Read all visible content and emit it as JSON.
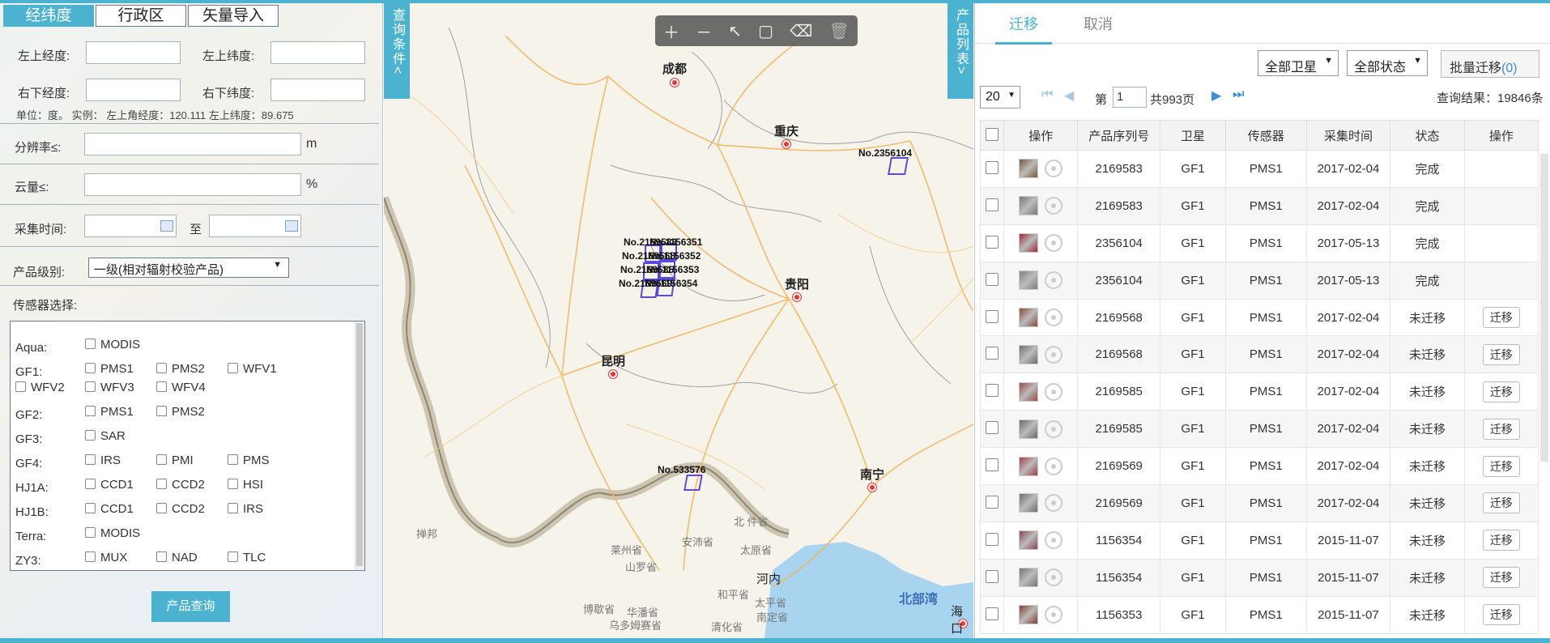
{
  "left_panel": {
    "tabs": [
      "经纬度",
      "行政区",
      "矢量导入"
    ],
    "fields": {
      "top_left_lon": "左上经度:",
      "top_left_lat": "左上纬度:",
      "bottom_right_lon": "右下经度:",
      "bottom_right_lat": "右下纬度:"
    },
    "note": "单位：度。 实例： 左上角经度：120.111    左上纬度：89.675",
    "resolution_label": "分辨率≤:",
    "resolution_unit": "m",
    "cloud_label": "云量≤:",
    "cloud_unit": "%",
    "time_label": "采集时间:",
    "time_to": "至",
    "level_label": "产品级别:",
    "level_value": "一级(相对辐射校验产品)",
    "sensor_label": "传感器选择:",
    "sensors": [
      {
        "sat": "Aqua:",
        "items": [
          "MODIS"
        ]
      },
      {
        "sat": "GF1:",
        "items": [
          "PMS1",
          "PMS2",
          "WFV1"
        ],
        "wrap": [
          "WFV2",
          "WFV3",
          "WFV4"
        ]
      },
      {
        "sat": "GF2:",
        "items": [
          "PMS1",
          "PMS2"
        ]
      },
      {
        "sat": "GF3:",
        "items": [
          "SAR"
        ]
      },
      {
        "sat": "GF4:",
        "items": [
          "IRS",
          "PMI",
          "PMS"
        ]
      },
      {
        "sat": "HJ1A:",
        "items": [
          "CCD1",
          "CCD2",
          "HSI"
        ]
      },
      {
        "sat": "HJ1B:",
        "items": [
          "CCD1",
          "CCD2",
          "IRS"
        ]
      },
      {
        "sat": "Terra:",
        "items": [
          "MODIS"
        ]
      },
      {
        "sat": "ZY3:",
        "items": [
          "MUX",
          "NAD",
          "TLC"
        ]
      }
    ],
    "query_button": "产品查询"
  },
  "map": {
    "left_tab": "查询条件<",
    "right_tab": "产品列表>",
    "toolbar_icons": [
      "plus-icon",
      "minus-icon",
      "select-icon",
      "rect-icon",
      "clear-select-icon",
      "delete-icon"
    ],
    "cities": {
      "chengdu": "成都",
      "chongqing": "重庆",
      "guiyang": "贵阳",
      "kunming": "昆明",
      "nanning": "南宁",
      "hanoi": "河内",
      "haikou": "海口"
    },
    "places": [
      "掸邦",
      "莱州省",
      "安沛省",
      "山罗省",
      "北 件省",
      "太原省",
      "和平省",
      "太平省",
      "清化省",
      "南定省",
      "博歇省",
      "华潘省",
      "乌多姆赛省",
      "北"
    ],
    "gulf": "北部湾",
    "labels": {
      "p1": "No.2356104",
      "p2": "No.2169583",
      "p3": "No.1156351",
      "p4": "No.2169568",
      "p5": "No.1156352",
      "p6": "No.2169585",
      "p7": "No.1156353",
      "p8": "No.2169569",
      "p9": "No.1156354",
      "p10": "No.533576"
    }
  },
  "right_panel": {
    "tabs": [
      "迁移",
      "取消"
    ],
    "satellite_select": "全部卫星",
    "status_select": "全部状态",
    "batch_button": "批量迁移",
    "batch_count": "(0)",
    "page_size": "20",
    "page_prefix": "第",
    "page_value": "1",
    "page_total": "共993页",
    "result_text": "查询结果：19846条",
    "columns": [
      "操作",
      "产品序列号",
      "卫星",
      "传感器",
      "采集时间",
      "状态",
      "操作"
    ],
    "migrate_label": "迁移",
    "rows": [
      {
        "id": "2169583",
        "sat": "GF1",
        "sensor": "PMS1",
        "date": "2017-02-04",
        "status": "完成",
        "action": false,
        "thumb": "#7a5a3a"
      },
      {
        "id": "2169583",
        "sat": "GF1",
        "sensor": "PMS1",
        "date": "2017-02-04",
        "status": "完成",
        "action": false,
        "thumb": "#777"
      },
      {
        "id": "2356104",
        "sat": "GF1",
        "sensor": "PMS1",
        "date": "2017-05-13",
        "status": "完成",
        "action": false,
        "thumb": "#a0283a"
      },
      {
        "id": "2356104",
        "sat": "GF1",
        "sensor": "PMS1",
        "date": "2017-05-13",
        "status": "完成",
        "action": false,
        "thumb": "#808080"
      },
      {
        "id": "2169568",
        "sat": "GF1",
        "sensor": "PMS1",
        "date": "2017-02-04",
        "status": "未迁移",
        "action": true,
        "thumb": "#8a4a3a"
      },
      {
        "id": "2169568",
        "sat": "GF1",
        "sensor": "PMS1",
        "date": "2017-02-04",
        "status": "未迁移",
        "action": true,
        "thumb": "#6e6e6e"
      },
      {
        "id": "2169585",
        "sat": "GF1",
        "sensor": "PMS1",
        "date": "2017-02-04",
        "status": "未迁移",
        "action": true,
        "thumb": "#9a4a40"
      },
      {
        "id": "2169585",
        "sat": "GF1",
        "sensor": "PMS1",
        "date": "2017-02-04",
        "status": "未迁移",
        "action": true,
        "thumb": "#6a6a6a"
      },
      {
        "id": "2169569",
        "sat": "GF1",
        "sensor": "PMS1",
        "date": "2017-02-04",
        "status": "未迁移",
        "action": true,
        "thumb": "#a04048"
      },
      {
        "id": "2169569",
        "sat": "GF1",
        "sensor": "PMS1",
        "date": "2017-02-04",
        "status": "未迁移",
        "action": true,
        "thumb": "#707070"
      },
      {
        "id": "1156354",
        "sat": "GF1",
        "sensor": "PMS1",
        "date": "2015-11-07",
        "status": "未迁移",
        "action": true,
        "thumb": "#8a4650"
      },
      {
        "id": "1156354",
        "sat": "GF1",
        "sensor": "PMS1",
        "date": "2015-11-07",
        "status": "未迁移",
        "action": true,
        "thumb": "#747474"
      },
      {
        "id": "1156353",
        "sat": "GF1",
        "sensor": "PMS1",
        "date": "2015-11-07",
        "status": "未迁移",
        "action": true,
        "thumb": "#8a3a30"
      }
    ]
  }
}
